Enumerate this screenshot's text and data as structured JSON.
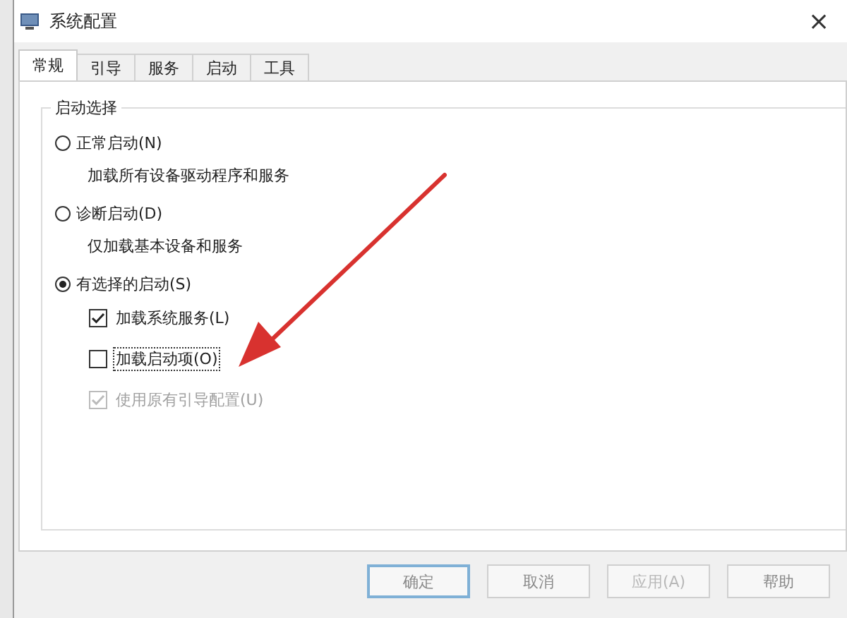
{
  "window": {
    "title": "系统配置",
    "close": "×"
  },
  "tabs": [
    {
      "label": "常规",
      "selected": true
    },
    {
      "label": "引导",
      "selected": false
    },
    {
      "label": "服务",
      "selected": false
    },
    {
      "label": "启动",
      "selected": false
    },
    {
      "label": "工具",
      "selected": false
    }
  ],
  "startup_group": {
    "title": "启动选择",
    "options": [
      {
        "label": "正常启动(N)",
        "selected": false,
        "description": "加载所有设备驱动程序和服务"
      },
      {
        "label": "诊断启动(D)",
        "selected": false,
        "description": "仅加载基本设备和服务"
      },
      {
        "label": "有选择的启动(S)",
        "selected": true
      }
    ],
    "checkboxes": [
      {
        "label": "加载系统服务(L)",
        "checked": true,
        "disabled": false,
        "focused": false
      },
      {
        "label": "加载启动项(O)",
        "checked": false,
        "disabled": false,
        "focused": true
      },
      {
        "label": "使用原有引导配置(U)",
        "checked": true,
        "disabled": true,
        "focused": false
      }
    ]
  },
  "buttons": [
    {
      "label": "确定",
      "default": true,
      "disabled": false
    },
    {
      "label": "取消",
      "default": false,
      "disabled": false
    },
    {
      "label": "应用(A)",
      "default": false,
      "disabled": true
    },
    {
      "label": "帮助",
      "default": false,
      "disabled": false
    }
  ]
}
